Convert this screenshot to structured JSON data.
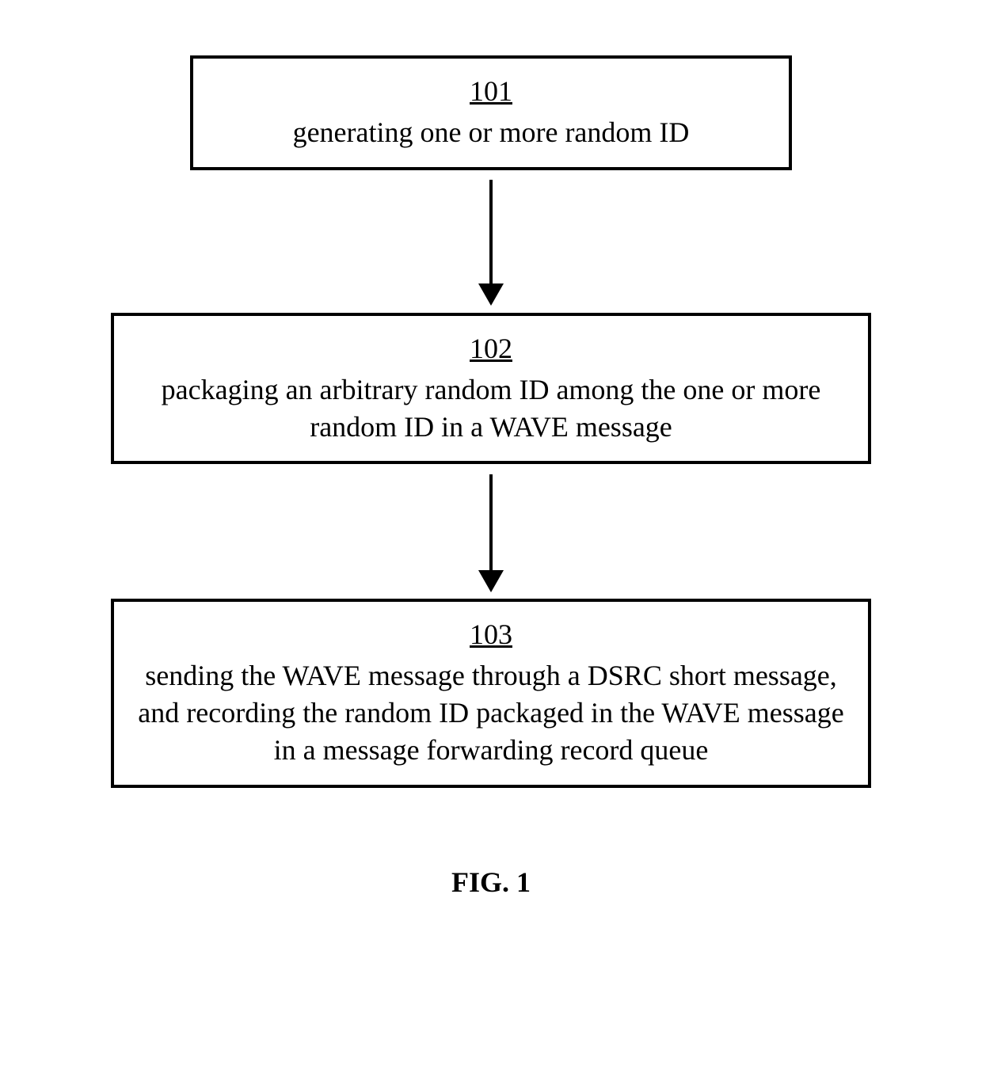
{
  "flowchart": {
    "steps": [
      {
        "number": "101",
        "text": "generating one or more random ID"
      },
      {
        "number": "102",
        "text": "packaging an arbitrary random ID among the one or more random ID in a WAVE message"
      },
      {
        "number": "103",
        "text": "sending the WAVE message through a DSRC short message, and recording the random ID packaged in the WAVE message in a message forwarding record queue"
      }
    ],
    "caption": "FIG. 1"
  }
}
